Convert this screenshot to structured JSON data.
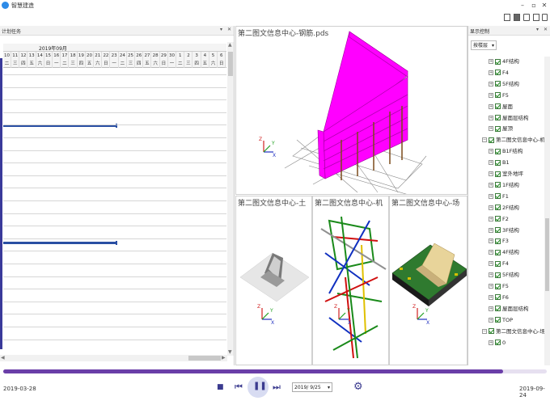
{
  "window": {
    "title": "智慧建造",
    "controls": [
      "–",
      "▫",
      "✕"
    ]
  },
  "left_panel": {
    "title": "计划任务",
    "pin": "▾",
    "close": "✕",
    "month": "2019年09月",
    "days": [
      "10",
      "11",
      "12",
      "13",
      "14",
      "15",
      "16",
      "17",
      "18",
      "19",
      "20",
      "21",
      "22",
      "23",
      "24",
      "25",
      "26",
      "27",
      "28",
      "29",
      "30",
      "1",
      "2",
      "3",
      "4",
      "5",
      "6"
    ],
    "weekdays": [
      "二",
      "三",
      "四",
      "五",
      "六",
      "日",
      "一",
      "二",
      "三",
      "四",
      "五",
      "六",
      "日",
      "一",
      "二",
      "三",
      "四",
      "五",
      "六",
      "日",
      "一",
      "二",
      "三",
      "四",
      "五",
      "六",
      "日"
    ]
  },
  "viewports": {
    "main": {
      "title": "第二图文信息中心-钢筋.pds"
    },
    "v1": {
      "title": "第二图文信息中心-土"
    },
    "v2": {
      "title": "第二图文信息中心-机"
    },
    "v3": {
      "title": "第二图文信息中心-场"
    }
  },
  "right_panel": {
    "title": "显示控制",
    "pin": "▾",
    "close": "✕",
    "layer_mode": "按楼层",
    "items": [
      {
        "label": "4F结构",
        "exp": "+",
        "level": 2
      },
      {
        "label": "F4",
        "exp": "+",
        "level": 2
      },
      {
        "label": "5F结构",
        "exp": "+",
        "level": 2
      },
      {
        "label": "F5",
        "exp": "+",
        "level": 2
      },
      {
        "label": "屋面",
        "exp": "+",
        "level": 2
      },
      {
        "label": "屋面层结构",
        "exp": "+",
        "level": 2
      },
      {
        "label": "屋顶",
        "exp": "+",
        "level": 2
      },
      {
        "label": "第二图文信息中心-机电",
        "exp": "−",
        "level": 1
      },
      {
        "label": "B1F结构",
        "exp": "+",
        "level": 2
      },
      {
        "label": "B1",
        "exp": "+",
        "level": 2
      },
      {
        "label": "室外地坪",
        "exp": "+",
        "level": 2
      },
      {
        "label": "1F结构",
        "exp": "+",
        "level": 2
      },
      {
        "label": "F1",
        "exp": "+",
        "level": 2
      },
      {
        "label": "2F结构",
        "exp": "+",
        "level": 2
      },
      {
        "label": "F2",
        "exp": "+",
        "level": 2
      },
      {
        "label": "3F结构",
        "exp": "+",
        "level": 2
      },
      {
        "label": "F3",
        "exp": "+",
        "level": 2
      },
      {
        "label": "4F结构",
        "exp": "+",
        "level": 2
      },
      {
        "label": "F4",
        "exp": "+",
        "level": 2
      },
      {
        "label": "5F结构",
        "exp": "+",
        "level": 2
      },
      {
        "label": "F5",
        "exp": "+",
        "level": 2
      },
      {
        "label": "F6",
        "exp": "+",
        "level": 2
      },
      {
        "label": "屋面层结构",
        "exp": "+",
        "level": 2
      },
      {
        "label": "TOP",
        "exp": "+",
        "level": 2
      },
      {
        "label": "第二图文信息中心-场布",
        "exp": "−",
        "level": 1
      },
      {
        "label": "0",
        "exp": "+",
        "level": 2
      }
    ]
  },
  "timeline": {
    "start_date": "2019-03-28",
    "end_date": "2019-09-24",
    "current_date": "2019/ 9/25",
    "progress": 0.92
  },
  "playback": {
    "stop": "■",
    "prev": "⏮",
    "pause": "❚❚",
    "next": "⏭",
    "settings": "⚙"
  },
  "colors": {
    "accent": "#6a3ea8",
    "task_bar": "#2a4fa3",
    "steel": "#ff00ff"
  }
}
